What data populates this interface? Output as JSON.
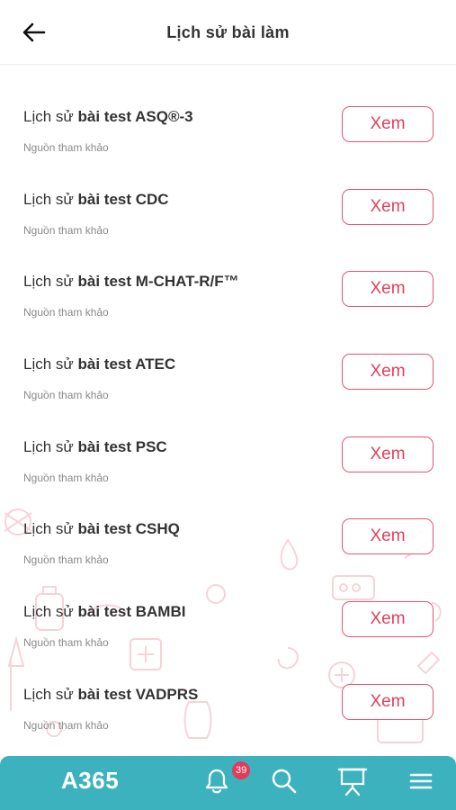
{
  "header": {
    "title": "Lịch sử bài làm",
    "back_icon": "arrow-left-icon"
  },
  "list": {
    "items": [
      {
        "prefix": "Lịch sử ",
        "name": "bài test ASQ®-3",
        "source": "Nguồn tham khảo",
        "action": "Xem"
      },
      {
        "prefix": "Lịch sử ",
        "name": "bài test CDC",
        "source": "Nguồn tham khảo",
        "action": "Xem"
      },
      {
        "prefix": "Lịch sử ",
        "name": "bài test M-CHAT-R/F™",
        "source": "Nguồn tham khảo",
        "action": "Xem"
      },
      {
        "prefix": "Lịch sử ",
        "name": "bài test ATEC",
        "source": "Nguồn tham khảo",
        "action": "Xem"
      },
      {
        "prefix": "Lịch sử ",
        "name": "bài test PSC",
        "source": "Nguồn tham khảo",
        "action": "Xem"
      },
      {
        "prefix": "Lịch sử ",
        "name": "bài test CSHQ",
        "source": "Nguồn tham khảo",
        "action": "Xem"
      },
      {
        "prefix": "Lịch sử ",
        "name": "bài test BAMBI",
        "source": "Nguồn tham khảo",
        "action": "Xem"
      },
      {
        "prefix": "Lịch sử ",
        "name": "bài test VADPRS",
        "source": "Nguồn tham khảo",
        "action": "Xem"
      }
    ]
  },
  "bottom_nav": {
    "brand": "A365",
    "notification_count": "39",
    "icons": [
      "bell-icon",
      "search-icon",
      "presentation-icon",
      "menu-icon"
    ]
  },
  "colors": {
    "accent": "#e8546f",
    "nav_bg": "#3db2bf",
    "badge": "#e23b5b"
  }
}
